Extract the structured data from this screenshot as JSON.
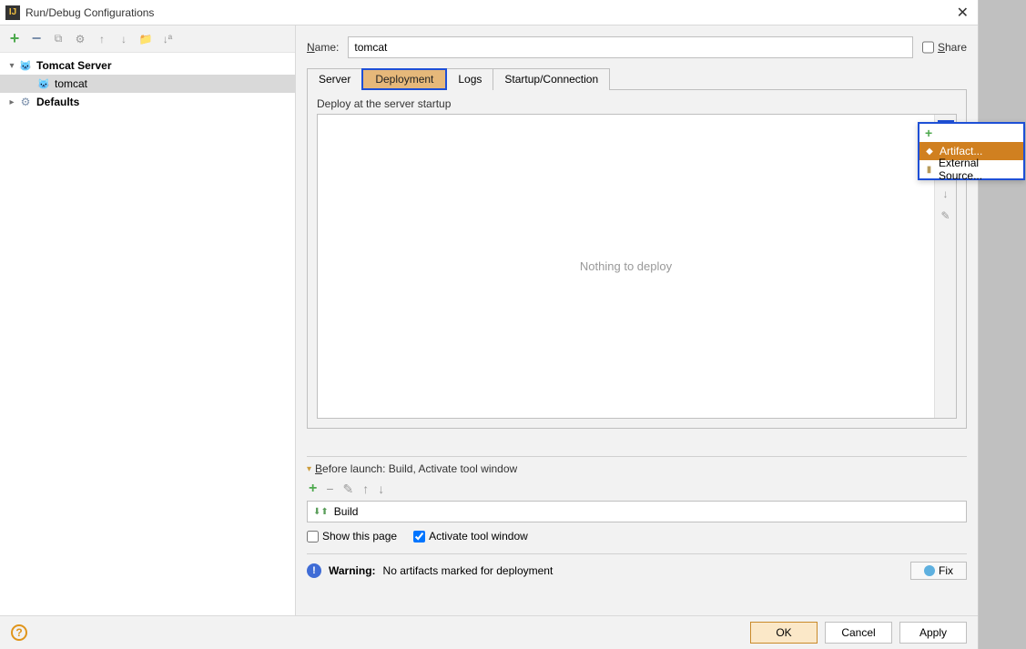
{
  "window": {
    "title": "Run/Debug Configurations"
  },
  "toolbar": {},
  "tree": {
    "items": [
      {
        "label": "Tomcat Server",
        "children": [
          {
            "label": "tomcat"
          }
        ]
      },
      {
        "label": "Defaults"
      }
    ]
  },
  "form": {
    "name_label": "Name:",
    "name_value": "tomcat",
    "share_label": "Share"
  },
  "tabs": {
    "items": [
      "Server",
      "Deployment",
      "Logs",
      "Startup/Connection"
    ],
    "active": 1
  },
  "deploy": {
    "section_title": "Deploy at the server startup",
    "placeholder": "Nothing to deploy"
  },
  "popup": {
    "items": [
      "Artifact...",
      "External Source..."
    ]
  },
  "before_launch": {
    "header": "Before launch: Build, Activate tool window",
    "list_item": "Build",
    "show_page": "Show this page",
    "activate": "Activate tool window"
  },
  "warning": {
    "label": "Warning:",
    "text": "No artifacts marked for deployment",
    "fix": "Fix"
  },
  "footer": {
    "ok": "OK",
    "cancel": "Cancel",
    "apply": "Apply"
  }
}
